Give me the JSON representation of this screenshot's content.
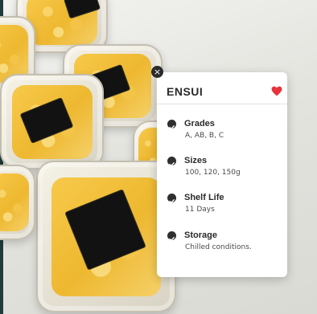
{
  "product": {
    "name": "ENSUI",
    "attributes": [
      {
        "label": "Grades",
        "value": "A, AB, B, C"
      },
      {
        "label": "Sizes",
        "value": "100,  120, 150g"
      },
      {
        "label": "Shelf Life",
        "value": "11 Days"
      },
      {
        "label": "Storage",
        "value": "Chilled conditions."
      }
    ]
  },
  "icons": {
    "close": "close-icon",
    "favorite": "heart-icon",
    "bullet": "check-circle-icon"
  },
  "colors": {
    "heart": "#e8323c",
    "check": "#2f2f2f",
    "roe": "#f2c040",
    "label": "#121212"
  }
}
